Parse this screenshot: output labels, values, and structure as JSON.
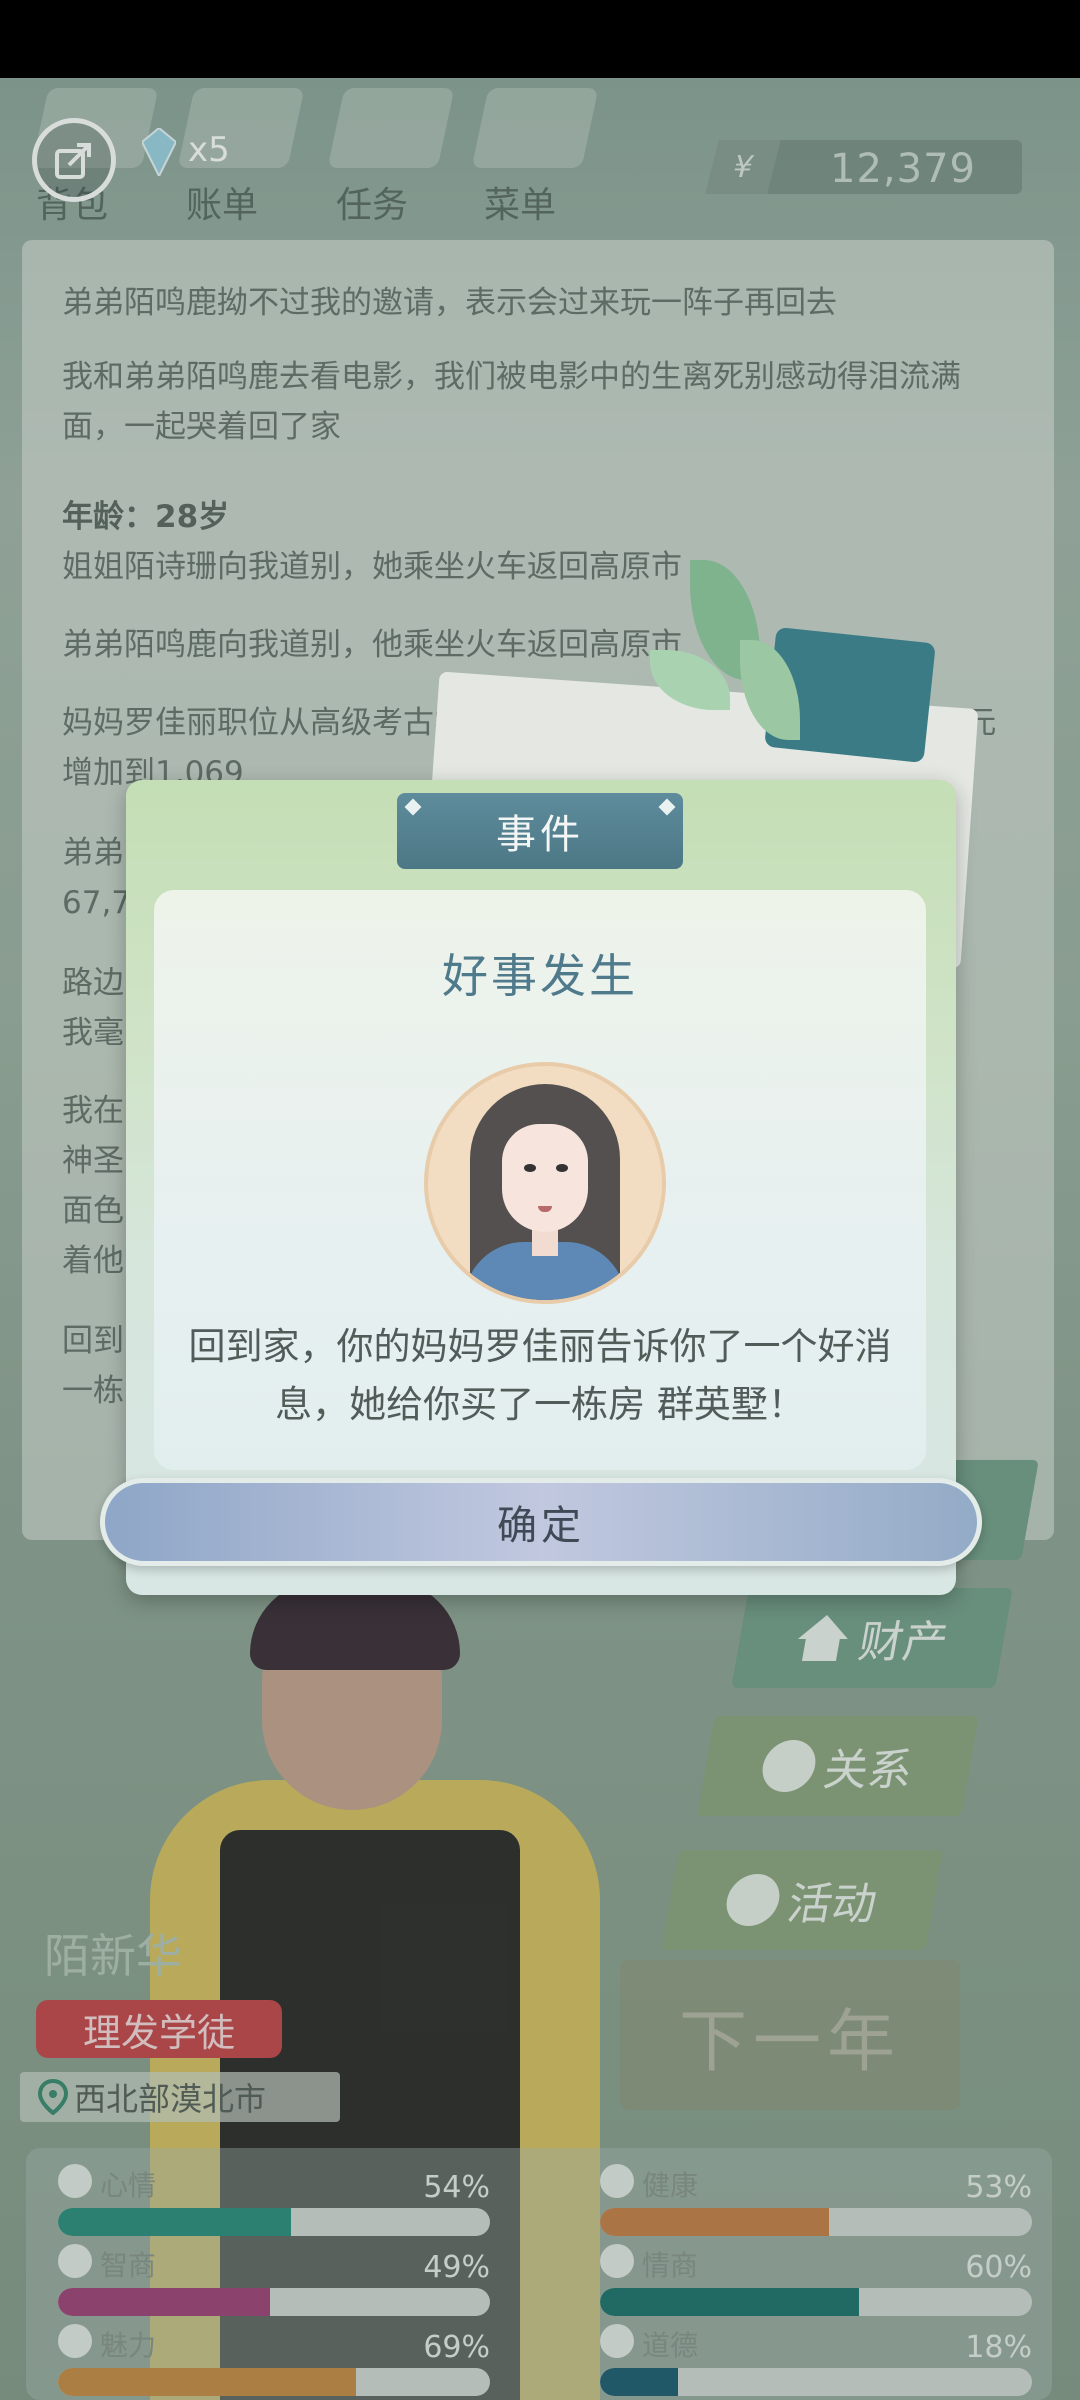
{
  "top": {
    "tabs": [
      "背包",
      "账单",
      "任务",
      "菜单"
    ],
    "gem_count": "x5",
    "currency_symbol": "¥",
    "money": "12,379"
  },
  "log": {
    "entries": [
      "弟弟陌鸣鹿拗不过我的邀请，表示会过来玩一阵子再回去",
      "我和弟弟陌鸣鹿去看电影，我们被电影中的生离死别感动得泪流满面，一起哭着回了家",
      "年龄：28岁",
      "姐姐陌诗珊向我道别，她乘坐火车返回高原市",
      "弟弟陌鸣鹿向我道别，他乘坐火车返回高原市",
      "妈妈罗佳丽职位从高级考古学家上升到考古专家，年薪从502,421元增加到1,069",
      "弟弟",
      "67,7",
      "路边",
      "我毫",
      "我在",
      "神圣",
      "面色",
      "着他",
      "回到",
      "一栋"
    ]
  },
  "side_buttons": {
    "property": "财产",
    "relations": "关系",
    "activity": "活动",
    "next_year": "下一年"
  },
  "character": {
    "name": "陌新华",
    "job": "理发学徒",
    "location": "西北部漠北市"
  },
  "stats": [
    {
      "label": "心情",
      "pct": "54%",
      "value": 54,
      "color": "#2e8f7f",
      "icon": "smile-icon"
    },
    {
      "label": "健康",
      "pct": "53%",
      "value": 53,
      "color": "#c7814a",
      "icon": "heart-icon"
    },
    {
      "label": "智商",
      "pct": "49%",
      "value": 49,
      "color": "#a1447a",
      "icon": "bulb-icon"
    },
    {
      "label": "情商",
      "pct": "60%",
      "value": 60,
      "color": "#20756f",
      "icon": "apple-icon"
    },
    {
      "label": "魅力",
      "pct": "69%",
      "value": 69,
      "color": "#c98e47",
      "icon": "sparkle-icon"
    },
    {
      "label": "道德",
      "pct": "18%",
      "value": 18,
      "color": "#1f5f73",
      "icon": "scale-icon"
    }
  ],
  "modal": {
    "tab": "事件",
    "title": "好事发生",
    "message": "回到家，你的妈妈罗佳丽告诉你了一个好消息，她给你买了一栋房 群英墅！",
    "confirm": "确定"
  }
}
